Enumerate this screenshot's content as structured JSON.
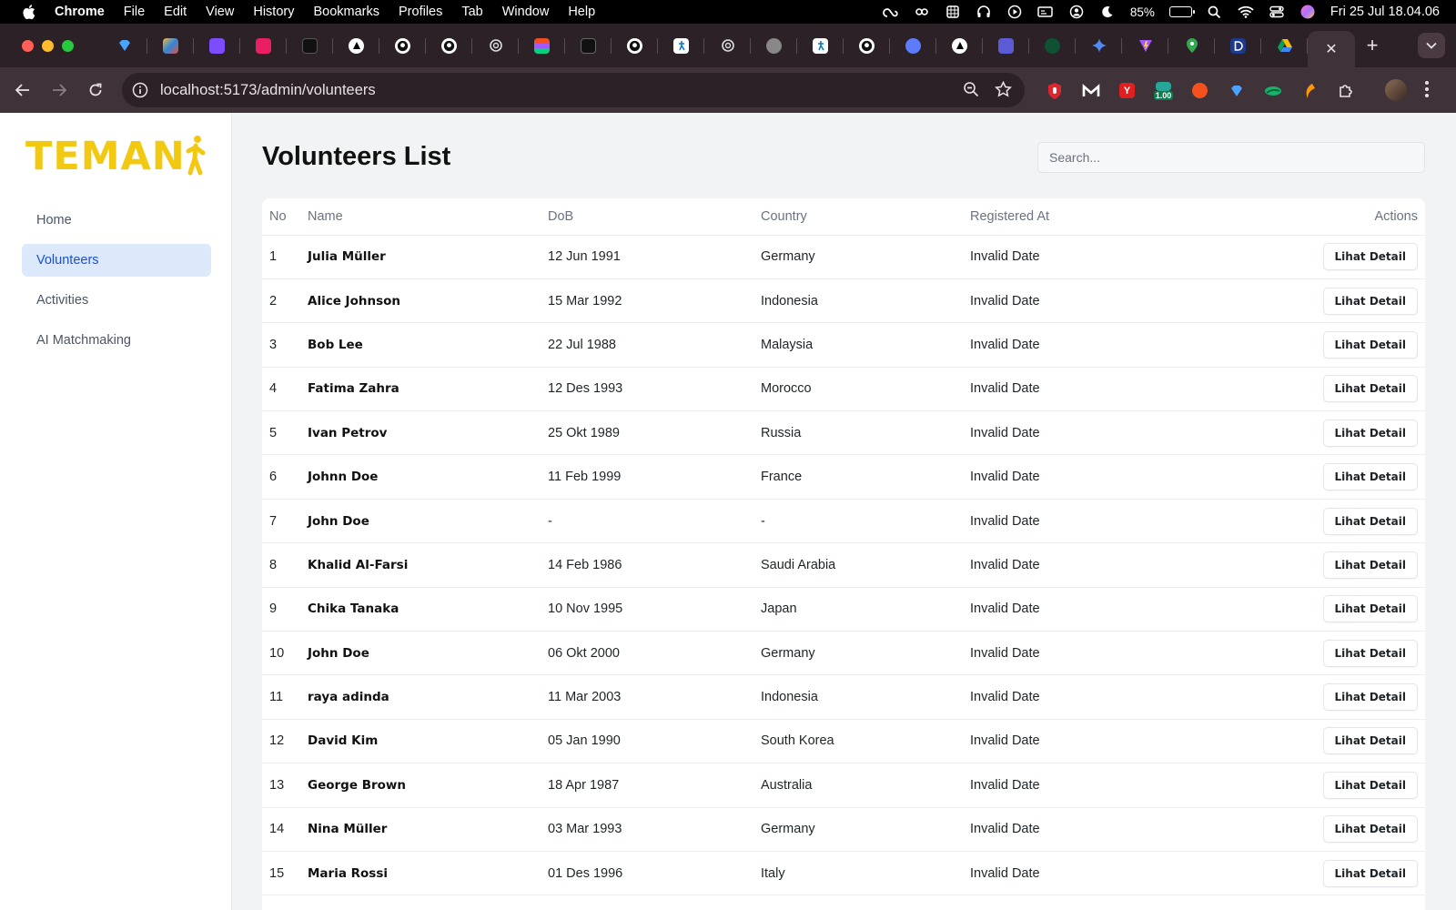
{
  "menubar": {
    "app_name": "Chrome",
    "items": [
      "File",
      "Edit",
      "View",
      "History",
      "Bookmarks",
      "Profiles",
      "Tab",
      "Window",
      "Help"
    ],
    "battery_percent": "85%",
    "battery_level": 0.85,
    "clock": "Fri 25 Jul  18.04.06"
  },
  "browser": {
    "url": "localhost:5173/admin/volunteers",
    "extension_badge": "1.00"
  },
  "app": {
    "logo": "TEMAN",
    "brand_color": "#f2c811",
    "accent_color": "#1d4ed8",
    "nav": [
      {
        "label": "Home"
      },
      {
        "label": "Volunteers"
      },
      {
        "label": "Activities"
      },
      {
        "label": "AI Matchmaking"
      }
    ],
    "active_nav": "Volunteers"
  },
  "page": {
    "title": "Volunteers List",
    "search_placeholder": "Search..."
  },
  "table": {
    "headers": {
      "no": "No",
      "name": "Name",
      "dob": "DoB",
      "country": "Country",
      "registered": "Registered At",
      "actions": "Actions"
    },
    "action_label": "Lihat Detail",
    "rows": [
      {
        "no": "1",
        "name": "Julia Müller",
        "dob": "12 Jun 1991",
        "country": "Germany",
        "registered": "Invalid Date"
      },
      {
        "no": "2",
        "name": "Alice Johnson",
        "dob": "15 Mar 1992",
        "country": "Indonesia",
        "registered": "Invalid Date"
      },
      {
        "no": "3",
        "name": "Bob Lee",
        "dob": "22 Jul 1988",
        "country": "Malaysia",
        "registered": "Invalid Date"
      },
      {
        "no": "4",
        "name": "Fatima Zahra",
        "dob": "12 Des 1993",
        "country": "Morocco",
        "registered": "Invalid Date"
      },
      {
        "no": "5",
        "name": "Ivan Petrov",
        "dob": "25 Okt 1989",
        "country": "Russia",
        "registered": "Invalid Date"
      },
      {
        "no": "6",
        "name": "Johnn Doe",
        "dob": "11 Feb 1999",
        "country": "France",
        "registered": "Invalid Date"
      },
      {
        "no": "7",
        "name": "John Doe",
        "dob": "-",
        "country": "-",
        "registered": "Invalid Date"
      },
      {
        "no": "8",
        "name": "Khalid Al-Farsi",
        "dob": "14 Feb 1986",
        "country": "Saudi Arabia",
        "registered": "Invalid Date"
      },
      {
        "no": "9",
        "name": "Chika Tanaka",
        "dob": "10 Nov 1995",
        "country": "Japan",
        "registered": "Invalid Date"
      },
      {
        "no": "10",
        "name": "John Doe",
        "dob": "06 Okt 2000",
        "country": "Germany",
        "registered": "Invalid Date"
      },
      {
        "no": "11",
        "name": "raya adinda",
        "dob": "11 Mar 2003",
        "country": "Indonesia",
        "registered": "Invalid Date"
      },
      {
        "no": "12",
        "name": "David Kim",
        "dob": "05 Jan 1990",
        "country": "South Korea",
        "registered": "Invalid Date"
      },
      {
        "no": "13",
        "name": "George Brown",
        "dob": "18 Apr 1987",
        "country": "Australia",
        "registered": "Invalid Date"
      },
      {
        "no": "14",
        "name": "Nina Müller",
        "dob": "03 Mar 1993",
        "country": "Germany",
        "registered": "Invalid Date"
      },
      {
        "no": "15",
        "name": "Maria Rossi",
        "dob": "01 Des 1996",
        "country": "Italy",
        "registered": "Invalid Date"
      }
    ]
  }
}
